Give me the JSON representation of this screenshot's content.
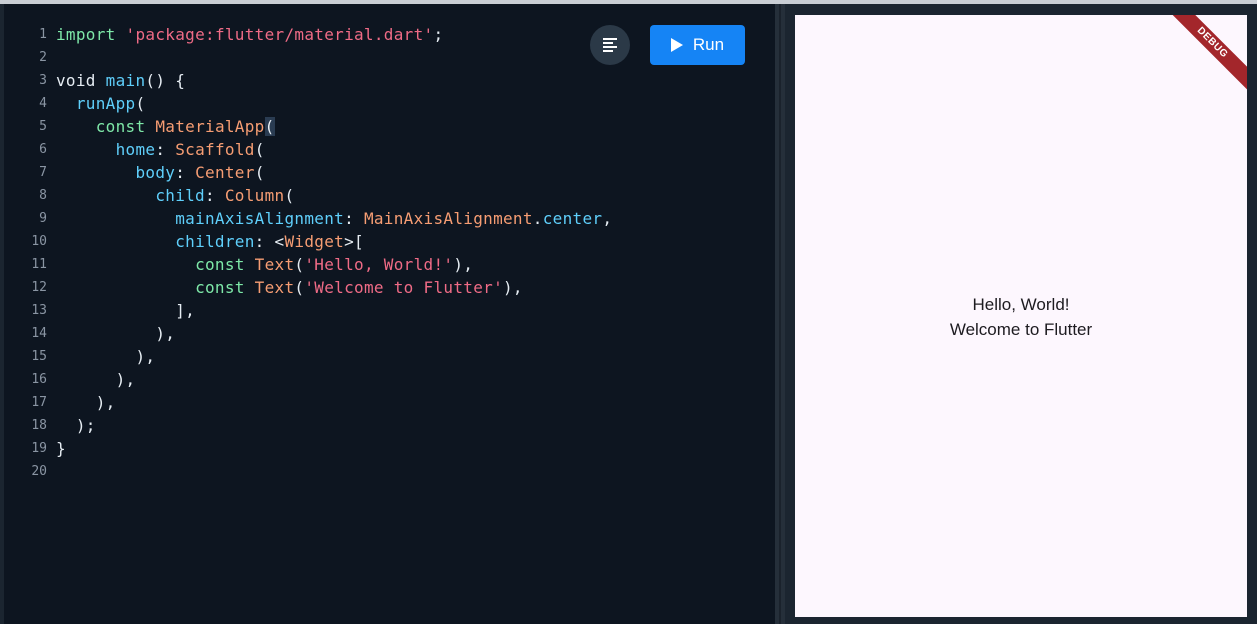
{
  "editor": {
    "lines": [
      {
        "n": "1",
        "tokens": [
          [
            "k",
            "import"
          ],
          [
            "p",
            " "
          ],
          [
            "s",
            "'package:flutter/material.dart'"
          ],
          [
            "p",
            ";"
          ]
        ]
      },
      {
        "n": "2",
        "tokens": []
      },
      {
        "n": "3",
        "tokens": [
          [
            "p",
            "void "
          ],
          [
            "f",
            "main"
          ],
          [
            "p",
            "() {"
          ]
        ]
      },
      {
        "n": "4",
        "tokens": [
          [
            "p",
            "  "
          ],
          [
            "f",
            "runApp"
          ],
          [
            "p",
            "("
          ]
        ]
      },
      {
        "n": "5",
        "tokens": [
          [
            "p",
            "    "
          ],
          [
            "k",
            "const "
          ],
          [
            "c",
            "MaterialApp"
          ],
          [
            "h",
            "("
          ]
        ]
      },
      {
        "n": "6",
        "tokens": [
          [
            "p",
            "      "
          ],
          [
            "f",
            "home"
          ],
          [
            "p",
            ": "
          ],
          [
            "c",
            "Scaffold"
          ],
          [
            "p",
            "("
          ]
        ]
      },
      {
        "n": "7",
        "tokens": [
          [
            "p",
            "        "
          ],
          [
            "f",
            "body"
          ],
          [
            "p",
            ": "
          ],
          [
            "c",
            "Center"
          ],
          [
            "p",
            "("
          ]
        ]
      },
      {
        "n": "8",
        "tokens": [
          [
            "p",
            "          "
          ],
          [
            "f",
            "child"
          ],
          [
            "p",
            ": "
          ],
          [
            "c",
            "Column"
          ],
          [
            "p",
            "("
          ]
        ]
      },
      {
        "n": "9",
        "tokens": [
          [
            "p",
            "            "
          ],
          [
            "f",
            "mainAxisAlignment"
          ],
          [
            "p",
            ": "
          ],
          [
            "c",
            "MainAxisAlignment"
          ],
          [
            "p",
            "."
          ],
          [
            "f",
            "center"
          ],
          [
            "p",
            ","
          ]
        ]
      },
      {
        "n": "10",
        "tokens": [
          [
            "p",
            "            "
          ],
          [
            "f",
            "children"
          ],
          [
            "p",
            ": <"
          ],
          [
            "c",
            "Widget"
          ],
          [
            "p",
            ">["
          ]
        ]
      },
      {
        "n": "11",
        "tokens": [
          [
            "p",
            "              "
          ],
          [
            "k",
            "const "
          ],
          [
            "c",
            "Text"
          ],
          [
            "p",
            "("
          ],
          [
            "s",
            "'Hello, World!'"
          ],
          [
            "p",
            "),"
          ]
        ]
      },
      {
        "n": "12",
        "tokens": [
          [
            "p",
            "              "
          ],
          [
            "k",
            "const "
          ],
          [
            "c",
            "Text"
          ],
          [
            "p",
            "("
          ],
          [
            "s",
            "'Welcome to Flutter'"
          ],
          [
            "p",
            "),"
          ]
        ]
      },
      {
        "n": "13",
        "tokens": [
          [
            "p",
            "            ],"
          ]
        ]
      },
      {
        "n": "14",
        "tokens": [
          [
            "p",
            "          ),"
          ]
        ]
      },
      {
        "n": "15",
        "tokens": [
          [
            "p",
            "        ),"
          ]
        ]
      },
      {
        "n": "16",
        "tokens": [
          [
            "p",
            "      ),"
          ]
        ]
      },
      {
        "n": "17",
        "tokens": [
          [
            "p",
            "    ),"
          ]
        ]
      },
      {
        "n": "18",
        "tokens": [
          [
            "p",
            "  );"
          ]
        ]
      },
      {
        "n": "19",
        "tokens": [
          [
            "p",
            "}"
          ]
        ]
      },
      {
        "n": "20",
        "tokens": []
      }
    ]
  },
  "toolbar": {
    "format_icon": "format-align-left-icon",
    "run_label": "Run",
    "run_icon": "play-icon"
  },
  "preview": {
    "line1": "Hello, World!",
    "line2": "Welcome to Flutter",
    "debug_banner": "DEBUG"
  },
  "colors": {
    "accent": "#1584f5",
    "editor_bg": "#0d1520",
    "preview_bg": "#fdf7fe",
    "debug_banner": "#a3262b"
  }
}
